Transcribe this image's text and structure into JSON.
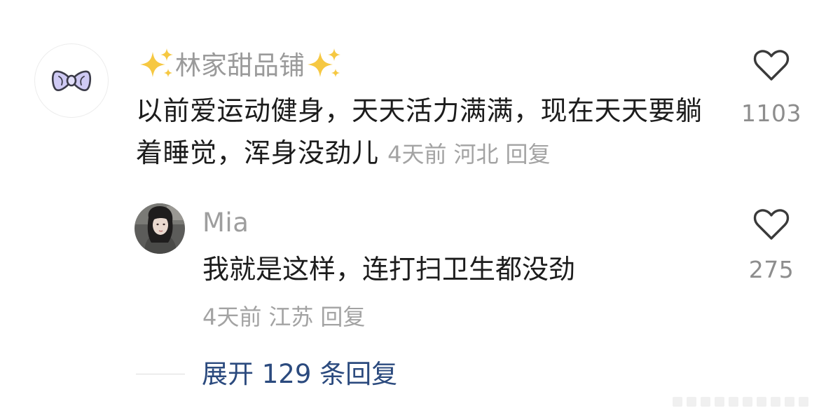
{
  "main_comment": {
    "username": "林家甜品铺",
    "text": "以前爱运动健身，天天活力满满，现在天天要躺着睡觉，浑身没劲儿",
    "time": "4天前",
    "location": "河北",
    "reply_label": "回复",
    "likes": "1103"
  },
  "reply_comment": {
    "username": "Mia",
    "text": "我就是这样，连打扫卫生都没劲",
    "time": "4天前",
    "location": "江苏",
    "reply_label": "回复",
    "likes": "275"
  },
  "expand": {
    "label": "展开 129 条回复"
  },
  "icons": {
    "avatar_main": "bow-icon",
    "sparkle": "sparkles-icon",
    "like": "heart-outline-icon"
  },
  "colors": {
    "username": "#9a9a9a",
    "body_text": "#1c1c1c",
    "meta_text": "#a3a3a3",
    "expand_link": "#2b4a7e",
    "sparkle": "#f6c842",
    "bow": "#c9c5f2"
  }
}
